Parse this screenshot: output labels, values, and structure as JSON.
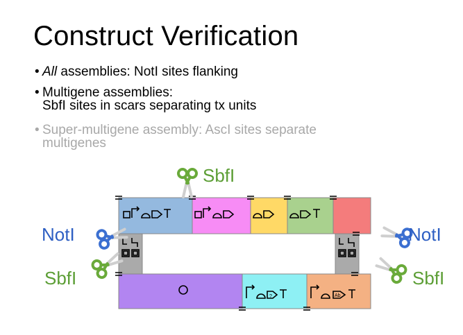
{
  "slide": {
    "title": "Construct Verification",
    "bullets": [
      {
        "emph": "All",
        "rest": " assemblies: NotI sites flanking",
        "line2": ""
      },
      {
        "emph": "",
        "rest": "Multigene assemblies:",
        "line2": "SbfI sites in scars separating tx units"
      },
      {
        "emph": "",
        "rest": "Super-multigene assembly: AscI sites separate",
        "line2": "multigenes"
      }
    ]
  },
  "diagram": {
    "labels": {
      "sbfi_top": "SbfI",
      "noti_left": "NotI",
      "sbfi_left": "SbfI",
      "noti_right": "NotI",
      "sbfi_right": "SbfI"
    },
    "colors": {
      "blue": "#94b9df",
      "magenta": "#f78cf5",
      "yellow": "#ffd966",
      "green": "#a9d18e",
      "red": "#f47c7c",
      "grey": "#aaaaaa",
      "purple": "#b285f1",
      "cyan": "#8ef0f4",
      "orange": "#f4b183",
      "scissor_blue": "#3b6fd1",
      "scissor_green": "#6aaa3a",
      "label_blue": "#2e5fc3",
      "label_green": "#5c9e35"
    }
  }
}
